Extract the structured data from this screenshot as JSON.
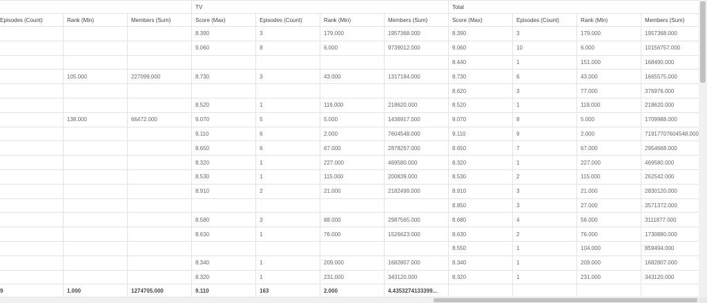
{
  "groups": [
    {
      "label": "",
      "span": 3
    },
    {
      "label": "TV",
      "span": 4
    },
    {
      "label": "Total",
      "span": 4
    }
  ],
  "columns": [
    "Episodes (Count)",
    "Rank (Min)",
    "Members (Sum)",
    "Score (Max)",
    "Episodes (Count)",
    "Rank (Min)",
    "Members (Sum)",
    "Score (Max)",
    "Episodes (Count)",
    "Rank (Min)",
    "Members (Sum)"
  ],
  "rows": [
    [
      "",
      "",
      "",
      "8.390",
      "3",
      "179.000",
      "1957368.000",
      "8.390",
      "3",
      "179.000",
      "1957368.000"
    ],
    [
      "",
      "",
      "",
      "9.060",
      "8",
      "6.000",
      "9739012.000",
      "9.060",
      "10",
      "6.000",
      "10156757.000"
    ],
    [
      "",
      "",
      "",
      "",
      "",
      "",
      "",
      "8.440",
      "1",
      "151.000",
      "168490.000"
    ],
    [
      "",
      "105.000",
      "227099.000",
      "8.730",
      "3",
      "43.000",
      "1317184.000",
      "8.730",
      "6",
      "43.000",
      "1665575.000"
    ],
    [
      "",
      "",
      "",
      "",
      "",
      "",
      "",
      "8.620",
      "3",
      "77.000",
      "376976.000"
    ],
    [
      "",
      "",
      "",
      "8.520",
      "1",
      "119.000",
      "218620.000",
      "8.520",
      "1",
      "119.000",
      "218620.000"
    ],
    [
      "",
      "138.000",
      "66472.000",
      "9.070",
      "5",
      "5.000",
      "1436917.000",
      "9.070",
      "8",
      "5.000",
      "1709988.000"
    ],
    [
      "",
      "",
      "",
      "9.110",
      "6",
      "2.000",
      "7604548.000",
      "9.110",
      "9",
      "2.000",
      "71917707604548.000"
    ],
    [
      "",
      "",
      "",
      "8.650",
      "6",
      "67.000",
      "2878267.000",
      "8.650",
      "7",
      "67.000",
      "2954668.000"
    ],
    [
      "",
      "",
      "",
      "8.320",
      "1",
      "227.000",
      "469580.000",
      "8.320",
      "1",
      "227.000",
      "469580.000"
    ],
    [
      "",
      "",
      "",
      "8.530",
      "1",
      "115.000",
      "200839.000",
      "8.530",
      "2",
      "115.000",
      "262542.000"
    ],
    [
      "",
      "",
      "",
      "8.910",
      "2",
      "21.000",
      "2182499.000",
      "8.910",
      "3",
      "21.000",
      "2830120.000"
    ],
    [
      "",
      "",
      "",
      "",
      "",
      "",
      "",
      "8.850",
      "3",
      "27.000",
      "3571372.000"
    ],
    [
      "",
      "",
      "",
      "8.580",
      "3",
      "88.000",
      "2987565.000",
      "8.680",
      "4",
      "56.000",
      "3111877.000"
    ],
    [
      "",
      "",
      "",
      "8.630",
      "1",
      "76.000",
      "1526623.000",
      "8.630",
      "2",
      "76.000",
      "1730880.000"
    ],
    [
      "",
      "",
      "",
      "",
      "",
      "",
      "",
      "8.550",
      "1",
      "104.000",
      "859494.000"
    ],
    [
      "",
      "",
      "",
      "8.340",
      "1",
      "209.000",
      "1682807.000",
      "8.340",
      "1",
      "209.000",
      "1682807.000"
    ],
    [
      "",
      "",
      "",
      "8.320",
      "1",
      "231.000",
      "343120.000",
      "8.320",
      "1",
      "231.000",
      "343120.000"
    ]
  ],
  "totals": [
    "9",
    "1.000",
    "1274705.000",
    "9.110",
    "163",
    "2.000",
    "4.4353274133399...",
    "",
    "",
    "",
    ""
  ]
}
